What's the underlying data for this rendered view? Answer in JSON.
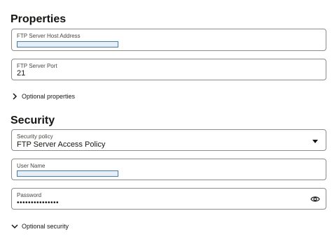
{
  "properties": {
    "title": "Properties",
    "host": {
      "label": "FTP Server Host Address",
      "value": ""
    },
    "port": {
      "label": "FTP Server Port",
      "value": "21"
    },
    "optional_label": "Optional properties"
  },
  "security": {
    "title": "Security",
    "policy": {
      "label": "Security policy",
      "value": "FTP Server Access Policy"
    },
    "username": {
      "label": "User Name",
      "value": ""
    },
    "password": {
      "label": "Password",
      "value": "•••••••••••••••"
    },
    "optional_label": "Optional security"
  },
  "icons": {
    "chevron_right": "chevron-right-icon",
    "chevron_down": "chevron-down-icon",
    "caret_down": "caret-down-icon",
    "eye": "eye-icon"
  },
  "colors": {
    "border": "#8f8b87",
    "text": "#161513",
    "redaction_border": "#3a7bd5"
  }
}
